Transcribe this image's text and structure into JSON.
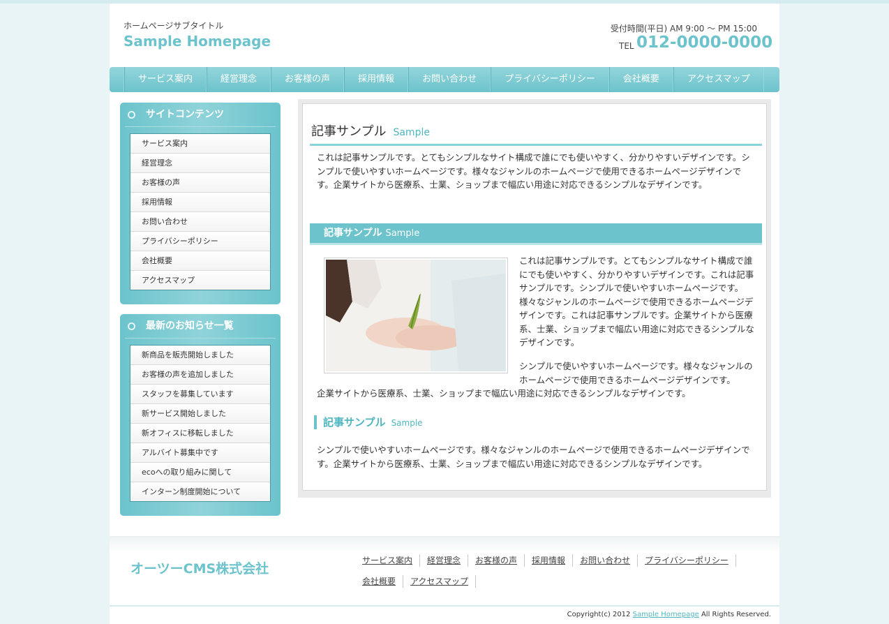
{
  "header": {
    "subtitle": "ホームページサブタイトル",
    "site_title": "Sample Homepage",
    "hours": "受付時間(平日) AM 9:00 〜 PM 15:00",
    "tel_label": "TEL",
    "tel_number": "012-0000-0000"
  },
  "nav": [
    "サービス案内",
    "経営理念",
    "お客様の声",
    "採用情報",
    "お問い合わせ",
    "プライバシーポリシー",
    "会社概要",
    "アクセスマップ"
  ],
  "sidebar": {
    "contents": {
      "title": "サイトコンテンツ",
      "items": [
        "サービス案内",
        "経営理念",
        "お客様の声",
        "採用情報",
        "お問い合わせ",
        "プライバシーポリシー",
        "会社概要",
        "アクセスマップ"
      ]
    },
    "news": {
      "title": "最新のお知らせ一覧",
      "items": [
        "新商品を販売開始しました",
        "お客様の声を追加しました",
        "スタッフを募集しています",
        "新サービス開始しました",
        "新オフィスに移転しました",
        "アルバイト募集中です",
        "ecoへの取り組みに関して",
        "インターン制度開始について"
      ]
    }
  },
  "main": {
    "h2": "記事サンプル",
    "h2_en": "Sample",
    "para1": "これは記事サンプルです。とてもシンプルなサイト構成で誰にでも使いやすく、分かりやすいデザインです。シンプルで使いやすいホームページです。様々なジャンルのホームページで使用できるホームページデザインです。企業サイトから医療系、士業、ショップまで幅広い用途に対応できるシンプルなデザインです。",
    "h3": "記事サンプル",
    "h3_en": "Sample",
    "para2": "これは記事サンプルです。とてもシンプルなサイト構成で誰にでも使いやすく、分かりやすいデザインです。これは記事サンプルです。シンプルで使いやすいホームページです。様々なジャンルのホームページで使用できるホームページデザインです。これは記事サンプルです。企業サイトから医療系、士業、ショップまで幅広い用途に対応できるシンプルなデザインです。",
    "para3": "シンプルで使いやすいホームページです。様々なジャンルのホームページで使用できるホームページデザインです。",
    "para3_tail": "企業サイトから医療系、士業、ショップまで幅広い用途に対応できるシンプルなデザインです。",
    "h4": "記事サンプル",
    "h4_en": "Sample",
    "para4": "シンプルで使いやすいホームページです。様々なジャンルのホームページで使用できるホームページデザインです。企業サイトから医療系、士業、ショップまで幅広い用途に対応できるシンプルなデザインです。"
  },
  "footer": {
    "company": "オーツーCMS株式会社",
    "links": [
      "サービス案内",
      "経営理念",
      "お客様の声",
      "採用情報",
      "お問い合わせ",
      "プライバシーポリシー",
      "会社概要",
      "アクセスマップ"
    ],
    "copyright_prefix": "Copyright(c) 2012",
    "copyright_link": "Sample Homepage",
    "copyright_suffix": "All Rights Reserved."
  },
  "colors": {
    "accent": "#6cc3cc",
    "accent_dark": "#4fb6c0",
    "background": "#e8f4f6"
  }
}
